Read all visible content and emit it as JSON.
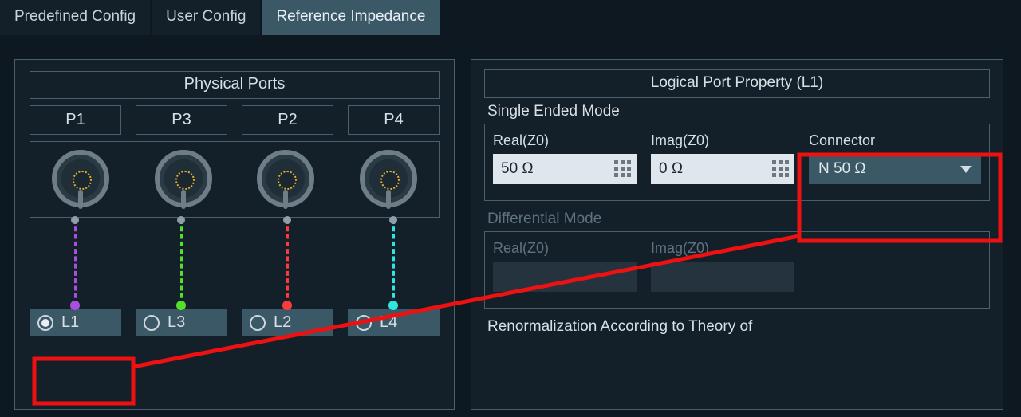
{
  "tabs": [
    {
      "label": "Predefined Config",
      "active": false
    },
    {
      "label": "User Config",
      "active": false
    },
    {
      "label": "Reference Impedance",
      "active": true
    }
  ],
  "physical_ports": {
    "title": "Physical Ports",
    "heads": [
      "P1",
      "P3",
      "P2",
      "P4"
    ],
    "line_colors": [
      "purple",
      "green",
      "red",
      "cyan"
    ],
    "logical": [
      {
        "label": "L1",
        "selected": true
      },
      {
        "label": "L3",
        "selected": false
      },
      {
        "label": "L2",
        "selected": false
      },
      {
        "label": "L4",
        "selected": false
      }
    ]
  },
  "property": {
    "title": "Logical Port Property (L1)",
    "single": {
      "label": "Single Ended Mode",
      "real_label": "Real(Z0)",
      "real_value": "50 Ω",
      "imag_label": "Imag(Z0)",
      "imag_value": "0 Ω",
      "connector_label": "Connector",
      "connector_value": "N 50 Ω"
    },
    "diff": {
      "label": "Differential Mode",
      "real_label": "Real(Z0)",
      "imag_label": "Imag(Z0)"
    },
    "renorm_label": "Renormalization According to Theory of"
  }
}
